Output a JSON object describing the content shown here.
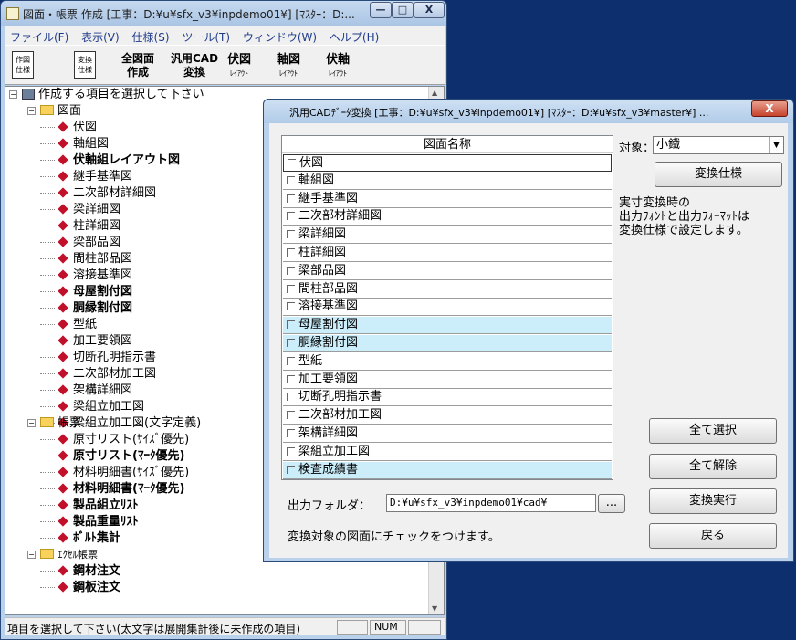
{
  "main_window": {
    "title": "図面・帳票 作成 [工事：D:¥u¥sfx_v3¥inpdemo01¥] [ﾏｽﾀｰ：D:...",
    "controls": {
      "minimize": "—",
      "maximize": "□",
      "close": "X"
    },
    "menu": [
      "ファイル(F)",
      "表示(V)",
      "仕様(S)",
      "ツール(T)",
      "ウィンドウ(W)",
      "ヘルプ(H)"
    ],
    "toolbar": {
      "icon1": [
        "作図",
        "仕様"
      ],
      "icon2": [
        "変換",
        "仕様"
      ],
      "buttons": [
        {
          "line1": "全図面",
          "line2": "作成",
          "style": "plain"
        },
        {
          "line1": "汎用CAD",
          "line2": "変換",
          "style": "plain"
        },
        {
          "line1": "伏図",
          "line2": "ﾚｲｱｳﾄ",
          "style": "layout"
        },
        {
          "line1": "軸図",
          "line2": "ﾚｲｱｳﾄ",
          "style": "layout"
        },
        {
          "line1": "伏軸",
          "line2": "ﾚｲｱｳﾄ",
          "style": "layout"
        }
      ]
    },
    "tree": {
      "root": "作成する項目を選択して下さい",
      "folder_drawings": "図面",
      "drawings": [
        {
          "label": "伏図",
          "bold": false
        },
        {
          "label": "軸組図",
          "bold": false
        },
        {
          "label": "伏軸組レイアウト図",
          "bold": true
        },
        {
          "label": "継手基準図",
          "bold": false
        },
        {
          "label": "二次部材詳細図",
          "bold": false
        },
        {
          "label": "梁詳細図",
          "bold": false
        },
        {
          "label": "柱詳細図",
          "bold": false
        },
        {
          "label": "梁部品図",
          "bold": false
        },
        {
          "label": "間柱部品図",
          "bold": false
        },
        {
          "label": "溶接基準図",
          "bold": false
        },
        {
          "label": "母屋割付図",
          "bold": true
        },
        {
          "label": "胴縁割付図",
          "bold": true
        },
        {
          "label": "型紙",
          "bold": false
        },
        {
          "label": "加工要領図",
          "bold": false
        },
        {
          "label": "切断孔明指示書",
          "bold": false
        },
        {
          "label": "二次部材加工図",
          "bold": false
        },
        {
          "label": "架構詳細図",
          "bold": false
        },
        {
          "label": "梁組立加工図",
          "bold": false
        },
        {
          "label": "梁組立加工図(文字定義)",
          "bold": false
        }
      ],
      "folder_forms": "帳票",
      "forms": [
        {
          "label": "原寸リスト(ｻｲｽﾞ優先)",
          "bold": false
        },
        {
          "label": "原寸リスト(ﾏｰｸ優先)",
          "bold": true
        },
        {
          "label": "材料明細書(ｻｲｽﾞ優先)",
          "bold": false
        },
        {
          "label": "材料明細書(ﾏｰｸ優先)",
          "bold": true
        },
        {
          "label": "製品組立ﾘｽﾄ",
          "bold": true
        },
        {
          "label": "製品重量ﾘｽﾄ",
          "bold": true
        },
        {
          "label": "ﾎﾞﾙﾄ集計",
          "bold": true
        }
      ],
      "folder_excel": "ｴｸｾﾙ帳票",
      "excel": [
        {
          "label": "鋼材注文",
          "bold": true
        },
        {
          "label": "鋼板注文",
          "bold": true
        }
      ]
    },
    "status": {
      "text": "項目を選択して下さい(太文字は展開集計後に未作成の項目)",
      "num": "NUM"
    }
  },
  "dialog": {
    "title": "汎用CADﾃﾞｰﾀ変換 [工事：D:¥u¥sfx_v3¥inpdemo01¥] [ﾏｽﾀｰ：D:¥u¥sfx_v3¥master¥] ...",
    "close": "X",
    "list_header": "図面名称",
    "rows": [
      {
        "label": "伏図",
        "selected": false
      },
      {
        "label": "軸組図",
        "selected": false
      },
      {
        "label": "継手基準図",
        "selected": false
      },
      {
        "label": "二次部材詳細図",
        "selected": false
      },
      {
        "label": "梁詳細図",
        "selected": false
      },
      {
        "label": "柱詳細図",
        "selected": false
      },
      {
        "label": "梁部品図",
        "selected": false
      },
      {
        "label": "間柱部品図",
        "selected": false
      },
      {
        "label": "溶接基準図",
        "selected": false
      },
      {
        "label": "母屋割付図",
        "selected": true
      },
      {
        "label": "胴縁割付図",
        "selected": true
      },
      {
        "label": "型紙",
        "selected": false
      },
      {
        "label": "加工要領図",
        "selected": false
      },
      {
        "label": "切断孔明指示書",
        "selected": false
      },
      {
        "label": "二次部材加工図",
        "selected": false
      },
      {
        "label": "架構詳細図",
        "selected": false
      },
      {
        "label": "梁組立加工図",
        "selected": false
      },
      {
        "label": "検査成績書",
        "selected": true
      }
    ],
    "target_label": "対象：",
    "target_value": "小鐵",
    "convert_spec_button": "変換仕様",
    "note": [
      "実寸変換時の",
      "出力ﾌｫﾝﾄと出力ﾌｫｰﾏｯﾄは",
      "変換仕様で設定します。"
    ],
    "select_all": "全て選択",
    "deselect_all": "全て解除",
    "execute": "変換実行",
    "back": "戻る",
    "output_folder_label": "出力フォルダ：",
    "output_folder_value": "D:¥u¥sfx_v3¥inpdemo01¥cad¥",
    "browse": "...",
    "hint": "変換対象の図面にチェックをつけます。"
  }
}
